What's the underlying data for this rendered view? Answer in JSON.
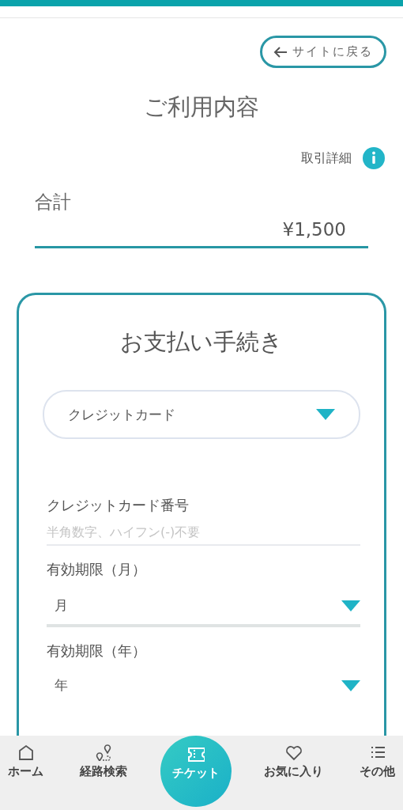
{
  "back_button": {
    "label": "サイトに戻る"
  },
  "title": "ご利用内容",
  "details_link": {
    "label": "取引詳細"
  },
  "total": {
    "label": "合計",
    "amount": "¥1,500"
  },
  "payment": {
    "title": "お支払い手続き",
    "method_select": {
      "value": "クレジットカード"
    },
    "fields": [
      {
        "kind": "text",
        "label": "クレジットカード番号",
        "placeholder": "半角数字、ハイフン(-)不要"
      },
      {
        "kind": "select",
        "label": "有効期限（月）",
        "value": "月"
      },
      {
        "kind": "select",
        "label": "有効期限（年）",
        "value": "年"
      }
    ]
  },
  "bottom_nav": [
    {
      "kind": "home",
      "label": "ホーム",
      "selected": false
    },
    {
      "kind": "route",
      "label": "経路検索",
      "selected": false
    },
    {
      "kind": "ticket",
      "label": "チケット",
      "selected": true
    },
    {
      "kind": "heart",
      "label": "お気に入り",
      "selected": false
    },
    {
      "kind": "list",
      "label": "その他",
      "selected": false
    }
  ]
}
